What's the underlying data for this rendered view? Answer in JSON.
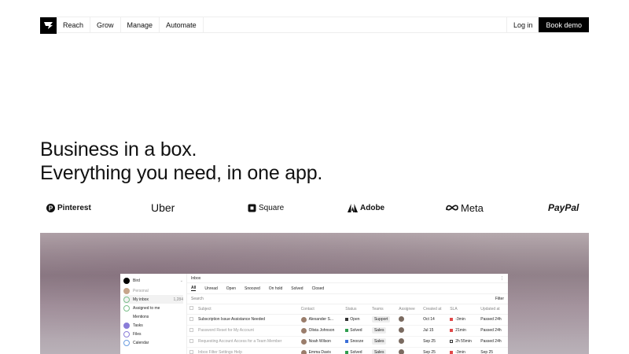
{
  "nav": {
    "items": [
      "Reach",
      "Grow",
      "Manage",
      "Automate"
    ],
    "login": "Log in",
    "demo": "Book demo"
  },
  "hero": {
    "line1": "Business in a box.",
    "line2": "Everything you need, in one app."
  },
  "logos": {
    "pinterest": "Pinterest",
    "uber": "Uber",
    "square": "Square",
    "adobe": "Adobe",
    "meta": "Meta",
    "paypal": "PayPal"
  },
  "app": {
    "workspace": "Bird",
    "sidebar": {
      "personal": "Personal",
      "my_inbox": "My inbox",
      "my_inbox_count": "1,284",
      "assigned": "Assigned to me",
      "mentions": "Mentions",
      "tasks": "Tasks",
      "files": "Files",
      "calendar": "Calendar"
    },
    "title": "Inbox",
    "kebab": "⋮",
    "tabs": [
      "All",
      "Unread",
      "Open",
      "Snoozed",
      "On hold",
      "Solved",
      "Closed"
    ],
    "search": "Search",
    "filter": "Filter",
    "columns": [
      "Subject",
      "Contact",
      "Status",
      "Teams",
      "Assignee",
      "Created at",
      "SLA",
      "Updated at"
    ],
    "rows": [
      {
        "subject": "Subscription Issue Assistance Needed",
        "contact": "Alexander S...",
        "status": "Open",
        "status_color": "#333333",
        "team": "Support",
        "created": "Oct 14",
        "sla": "-3min",
        "sla_color": "#e04848",
        "updated": "Passed 24h"
      },
      {
        "subject": "Password Reset for My Account",
        "contact": "Olivia Johnson",
        "status": "Solved",
        "status_color": "#2f9e4f",
        "team": "Sales",
        "created": "Jul 15",
        "sla": "21min",
        "sla_color": "#e04848",
        "updated": "Passed 24h"
      },
      {
        "subject": "Requesting Account Access for a Team Member",
        "contact": "Noah Wilson",
        "status": "Snooze",
        "status_color": "#3b6fd8",
        "team": "Sales",
        "created": "Sep 25",
        "sla": "2h 55min",
        "sla_color": "#ffffff",
        "updated": "Passed 24h"
      },
      {
        "subject": "Inbox Filter Settings Help",
        "contact": "Emma Davis",
        "status": "Solved",
        "status_color": "#2f9e4f",
        "team": "Sales",
        "created": "Sep 25",
        "sla": "-3min",
        "sla_color": "#e04848",
        "updated": "Sep 25"
      }
    ]
  }
}
